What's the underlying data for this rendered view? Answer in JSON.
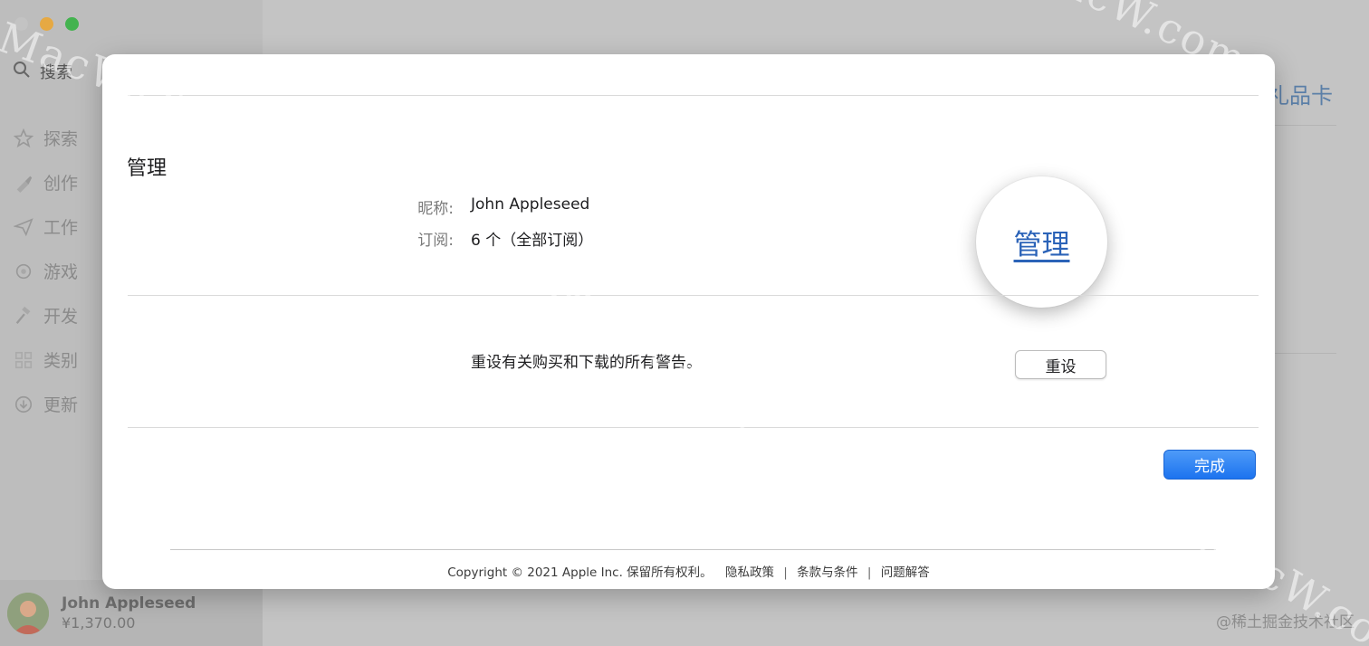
{
  "sidebar": {
    "search_label": "搜索",
    "items": [
      {
        "label": "探索",
        "icon": "star-icon"
      },
      {
        "label": "创作",
        "icon": "brush-icon"
      },
      {
        "label": "工作",
        "icon": "paper-plane-icon"
      },
      {
        "label": "游戏",
        "icon": "rocket-icon"
      },
      {
        "label": "开发",
        "icon": "hammer-icon"
      },
      {
        "label": "类别",
        "icon": "grid-icon"
      },
      {
        "label": "更新",
        "icon": "download-icon"
      }
    ],
    "user": {
      "name": "John Appleseed",
      "balance": "¥1,370.00"
    }
  },
  "background": {
    "gift_card": "礼品卡",
    "watermark_bottom": "@稀土掘金技术社区",
    "watermark_text": "MacW.com"
  },
  "modal": {
    "section_title": "管理",
    "nickname_label": "昵称:",
    "nickname_value": "John Appleseed",
    "subscriptions_label": "订阅:",
    "subscriptions_value": "6 个（全部订阅）",
    "manage_link": "管理",
    "reset_text": "重设有关购买和下载的所有警告。",
    "reset_button": "重设",
    "done_button": "完成",
    "footer": {
      "copyright": "Copyright © 2021 Apple Inc. 保留所有权利。",
      "privacy": "隐私政策",
      "terms": "条款与条件",
      "faq": "问题解答",
      "separator": "|"
    }
  },
  "colors": {
    "accent_blue": "#1c73ef",
    "link_blue": "#2b63b8",
    "traffic_min": "#e6a943",
    "traffic_max": "#43b34f"
  }
}
